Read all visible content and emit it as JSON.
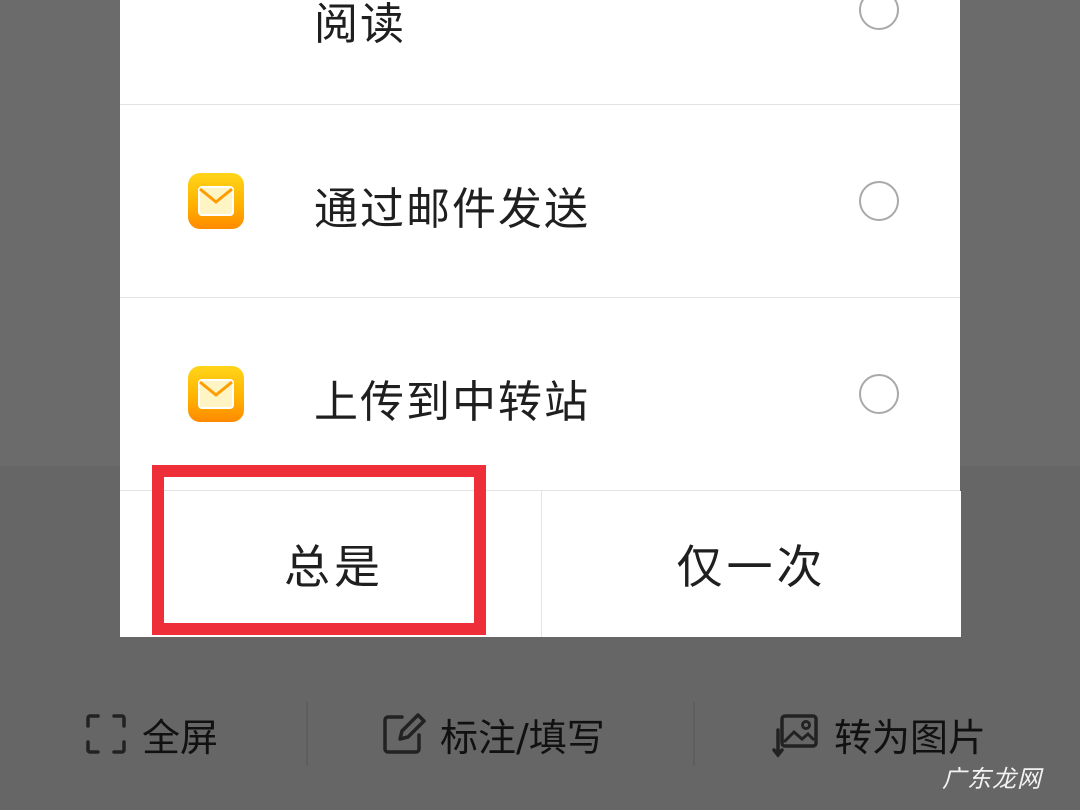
{
  "dialog": {
    "options": [
      {
        "label": "阅读",
        "icon": null,
        "selected": false
      },
      {
        "label": "通过邮件发送",
        "icon": "mail-app-icon",
        "selected": false
      },
      {
        "label": "上传到中转站",
        "icon": "mail-app-icon",
        "selected": false
      }
    ],
    "buttons": {
      "always": "总是",
      "once": "仅一次"
    },
    "highlight_color": "#ee2f3a",
    "icon_gradient": [
      "#ffd51a",
      "#ff8a00"
    ]
  },
  "toolbar": {
    "fullscreen": "全屏",
    "annotate": "标注/填写",
    "to_image": "转为图片"
  },
  "watermark": "广东龙网"
}
